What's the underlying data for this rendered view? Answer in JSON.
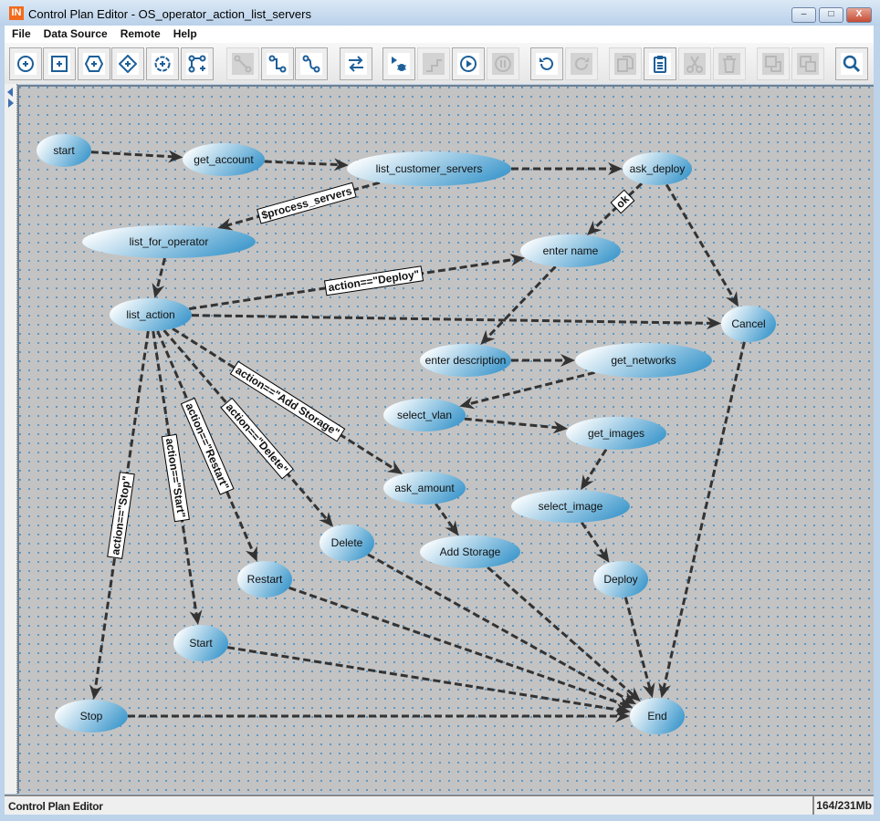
{
  "window": {
    "title": "Control Plan Editor - OS_operator_action_list_servers",
    "app_icon_text": "IN",
    "minimize": "–",
    "maximize": "□",
    "close": "X"
  },
  "menu": [
    {
      "label": "File"
    },
    {
      "label": "Data Source"
    },
    {
      "label": "Remote"
    },
    {
      "label": "Help"
    }
  ],
  "toolbar": [
    {
      "icon": "add-start-node-icon",
      "enabled": true
    },
    {
      "icon": "add-action-node-icon",
      "enabled": true
    },
    {
      "icon": "add-hexagon-node-icon",
      "enabled": true
    },
    {
      "icon": "add-decision-node-icon",
      "enabled": true
    },
    {
      "icon": "add-cloud-node-icon",
      "enabled": true
    },
    {
      "icon": "add-branch-icon",
      "enabled": true
    },
    {
      "icon": "connect-icon",
      "enabled": false
    },
    {
      "icon": "connect-step-icon",
      "enabled": true
    },
    {
      "icon": "connect-curve-icon",
      "enabled": true
    },
    {
      "icon": "swap-icon",
      "enabled": true
    },
    {
      "icon": "debug-icon",
      "enabled": true
    },
    {
      "icon": "step-icon",
      "enabled": false
    },
    {
      "icon": "play-icon",
      "enabled": true
    },
    {
      "icon": "pause-icon",
      "enabled": false
    },
    {
      "icon": "undo-icon",
      "enabled": true
    },
    {
      "icon": "redo-icon",
      "enabled": false
    },
    {
      "icon": "copy-icon",
      "enabled": false
    },
    {
      "icon": "paste-icon",
      "enabled": true
    },
    {
      "icon": "cut-icon",
      "enabled": false
    },
    {
      "icon": "delete-icon",
      "enabled": false
    },
    {
      "icon": "bring-front-icon",
      "enabled": false
    },
    {
      "icon": "send-back-icon",
      "enabled": false
    },
    {
      "icon": "search-icon",
      "enabled": true
    }
  ],
  "graph": {
    "node_gradient": [
      "#ffffff",
      "#3a96cb"
    ],
    "edge_color": "#333333",
    "grid_dot_color": "#4a8fc4",
    "background": "#c3c3c3",
    "nodes": [
      "start",
      "get_account",
      "list_customer_servers",
      "ask_deploy",
      "list_for_operator",
      "enter name",
      "list_action",
      "Cancel",
      "enter description",
      "get_networks",
      "select_vlan",
      "get_images",
      "ask_amount",
      "select_image",
      "Delete",
      "Add Storage",
      "Restart",
      "Deploy",
      "Start",
      "Stop",
      "End"
    ],
    "edges": [
      {
        "from": "start",
        "to": "get_account",
        "label": ""
      },
      {
        "from": "get_account",
        "to": "list_customer_servers",
        "label": ""
      },
      {
        "from": "list_customer_servers",
        "to": "ask_deploy",
        "label": ""
      },
      {
        "from": "list_customer_servers",
        "to": "list_for_operator",
        "label": "$process_servers"
      },
      {
        "from": "ask_deploy",
        "to": "enter name",
        "label": "ok"
      },
      {
        "from": "ask_deploy",
        "to": "Cancel",
        "label": ""
      },
      {
        "from": "list_for_operator",
        "to": "list_action",
        "label": ""
      },
      {
        "from": "list_action",
        "to": "enter name",
        "label": "action==\"Deploy\""
      },
      {
        "from": "list_action",
        "to": "Cancel",
        "label": ""
      },
      {
        "from": "enter name",
        "to": "enter description",
        "label": ""
      },
      {
        "from": "enter description",
        "to": "get_networks",
        "label": ""
      },
      {
        "from": "get_networks",
        "to": "select_vlan",
        "label": ""
      },
      {
        "from": "select_vlan",
        "to": "get_images",
        "label": ""
      },
      {
        "from": "get_images",
        "to": "select_image",
        "label": ""
      },
      {
        "from": "select_image",
        "to": "Deploy",
        "label": ""
      },
      {
        "from": "list_action",
        "to": "ask_amount",
        "label": "action==\"Add Storage\""
      },
      {
        "from": "ask_amount",
        "to": "Add Storage",
        "label": ""
      },
      {
        "from": "list_action",
        "to": "Delete",
        "label": "action==\"Delete\""
      },
      {
        "from": "list_action",
        "to": "Restart",
        "label": "action==\"Restart\""
      },
      {
        "from": "list_action",
        "to": "Start",
        "label": "action==\"Start\""
      },
      {
        "from": "list_action",
        "to": "Stop",
        "label": "action==\"Stop\""
      },
      {
        "from": "Cancel",
        "to": "End",
        "label": ""
      },
      {
        "from": "Delete",
        "to": "End",
        "label": ""
      },
      {
        "from": "Add Storage",
        "to": "End",
        "label": ""
      },
      {
        "from": "Restart",
        "to": "End",
        "label": ""
      },
      {
        "from": "Deploy",
        "to": "End",
        "label": ""
      },
      {
        "from": "Start",
        "to": "End",
        "label": ""
      },
      {
        "from": "Stop",
        "to": "End",
        "label": ""
      }
    ]
  },
  "status": {
    "left": "Control Plan Editor",
    "right": "164/231Mb"
  }
}
